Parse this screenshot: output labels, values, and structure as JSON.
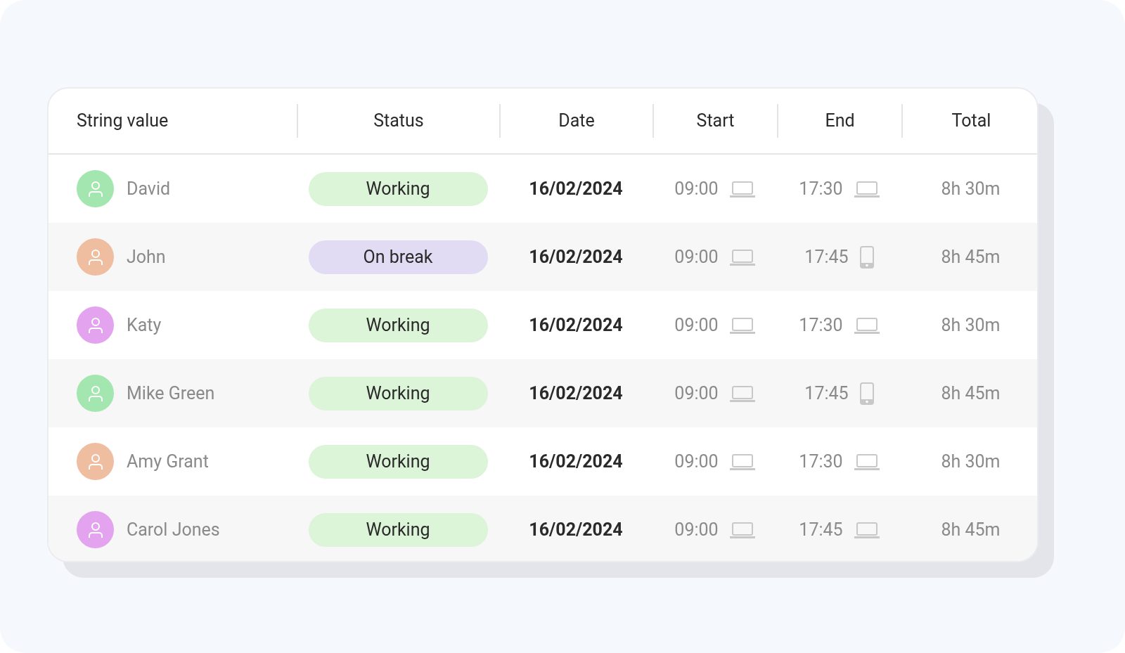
{
  "table": {
    "columns": [
      "String value",
      "Status",
      "Date",
      "Start",
      "End",
      "Total"
    ],
    "rows": [
      {
        "name": "David",
        "color": "#a3e6b0",
        "status": {
          "label": "Working",
          "kind": "working"
        },
        "date": "16/02/2024",
        "start": {
          "time": "09:00",
          "kind": "laptop"
        },
        "end": {
          "time": "17:30",
          "kind": "laptop"
        },
        "total": "8h 30m"
      },
      {
        "name": "John",
        "color": "#efbda0",
        "status": {
          "label": "On break",
          "kind": "break"
        },
        "date": "16/02/2024",
        "start": {
          "time": "09:00",
          "kind": "laptop"
        },
        "end": {
          "time": "17:45",
          "kind": "phone"
        },
        "total": "8h 45m"
      },
      {
        "name": "Katy",
        "color": "#e3a3ee",
        "status": {
          "label": "Working",
          "kind": "working"
        },
        "date": "16/02/2024",
        "start": {
          "time": "09:00",
          "kind": "laptop"
        },
        "end": {
          "time": "17:30",
          "kind": "laptop"
        },
        "total": "8h 30m"
      },
      {
        "name": "Mike Green",
        "color": "#a3e6b0",
        "status": {
          "label": "Working",
          "kind": "working"
        },
        "date": "16/02/2024",
        "start": {
          "time": "09:00",
          "kind": "laptop"
        },
        "end": {
          "time": "17:45",
          "kind": "phone"
        },
        "total": "8h 45m"
      },
      {
        "name": "Amy Grant",
        "color": "#efbda0",
        "status": {
          "label": "Working",
          "kind": "working"
        },
        "date": "16/02/2024",
        "start": {
          "time": "09:00",
          "kind": "laptop"
        },
        "end": {
          "time": "17:30",
          "kind": "laptop"
        },
        "total": "8h 30m"
      },
      {
        "name": "Carol Jones",
        "color": "#e3a3ee",
        "status": {
          "label": "Working",
          "kind": "working"
        },
        "date": "16/02/2024",
        "start": {
          "time": "09:00",
          "kind": "laptop"
        },
        "end": {
          "time": "17:45",
          "kind": "laptop"
        },
        "total": "8h 45m"
      }
    ]
  }
}
